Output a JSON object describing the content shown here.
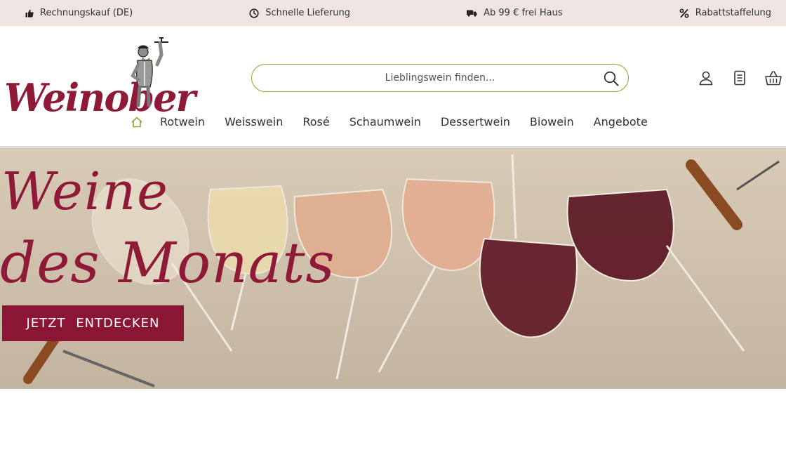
{
  "usp": [
    {
      "icon": "thumbs-up-icon",
      "label": "Rechnungskauf (DE)"
    },
    {
      "icon": "clock-icon",
      "label": "Schnelle Lieferung"
    },
    {
      "icon": "truck-icon",
      "label": "Ab 99 € frei Haus"
    },
    {
      "icon": "percent-icon",
      "label": "Rabattstaffelung"
    }
  ],
  "logo": {
    "text": "Weinober"
  },
  "search": {
    "placeholder": "Lieblingswein finden..."
  },
  "nav": {
    "items": [
      "Rotwein",
      "Weisswein",
      "Rosé",
      "Schaumwein",
      "Dessertwein",
      "Biowein",
      "Angebote"
    ]
  },
  "hero": {
    "headline_line1": "Weine",
    "headline_line2": "des Monats",
    "cta_label": "JETZT ENTDECKEN"
  },
  "colors": {
    "brand": "#8e1a37",
    "usp_bg": "#efe4e1",
    "search_border": "#8ea33a",
    "home_icon": "#8ea33a"
  }
}
